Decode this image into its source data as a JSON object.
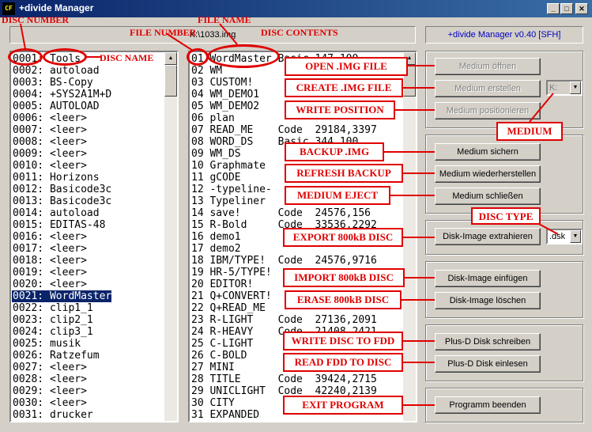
{
  "window": {
    "title": "+divide Manager",
    "app_icon": "CF",
    "controls": [
      "minimize",
      "maximize",
      "close"
    ]
  },
  "header": {
    "image_path": "K:\\1033.img",
    "version": "+divide Manager v0.40 [SFH]"
  },
  "discs": [
    "0001: Tools",
    "0002: autoload",
    "0003: BS-Copy",
    "0004: +SYS2A1M+D",
    "0005: AUTOLOAD",
    "0006: <leer>",
    "0007: <leer>",
    "0008: <leer>",
    "0009: <leer>",
    "0010: <leer>",
    "0011: Horizons",
    "0012: Basicode3c",
    "0013: Basicode3c",
    "0014: autoload",
    "0015: EDITAS-48",
    "0016: <leer>",
    "0017: <leer>",
    "0018: <leer>",
    "0019: <leer>",
    "0020: <leer>",
    "0021: WordMaster",
    "0022: clip1_1",
    "0023: clip2_1",
    "0024: clip3_1",
    "0025: musik",
    "0026: Ratzefum",
    "0027: <leer>",
    "0028: <leer>",
    "0029: <leer>",
    "0030: <leer>",
    "0031: drucker"
  ],
  "selected_disc_index": 20,
  "files": [
    "01 WordMaster Basic 147,100",
    "02 WM",
    "03 CUSTOM!",
    "04 WM_DEMO1",
    "05 WM_DEMO2",
    "06 plan",
    "07 READ_ME    Code  29184,3397",
    "08 WORD_DS    Basic 344,100",
    "09 WM_DS",
    "10 Graphmate",
    "11 gCODE",
    "12 -typeline-",
    "13 Typeliner",
    "14 save!      Code  24576,156",
    "15 R-Bold     Code  33536,2292",
    "16 demo1",
    "17 demo2",
    "18 IBM/TYPE!  Code  24576,9716",
    "19 HR-5/TYPE!",
    "20 EDITOR!",
    "21 Q+CONVERT!",
    "22 Q+READ_ME",
    "23 R-LIGHT    Code  27136,2091",
    "24 R-HEAVY    Code  21408,2421",
    "25 C-LIGHT",
    "26 C-BOLD",
    "27 MINI",
    "28 TITLE      Code  39424,2715",
    "29 UNICLIGHT  Code  42240,2139",
    "30 CITY",
    "31 EXPANDED"
  ],
  "buttons": {
    "open": "Medium öffnen",
    "create": "Medium erstellen",
    "position": "Medium positionieren",
    "backup": "Medium sichern",
    "restore": "Medium wiederherstellen",
    "close": "Medium schließen",
    "extract": "Disk-Image extrahieren",
    "insert": "Disk-Image einfügen",
    "delete": "Disk-Image löschen",
    "write_fdd": "Plus-D Disk schreiben",
    "read_fdd": "Plus-D Disk einlesen",
    "exit": "Programm beenden"
  },
  "medium_combo": {
    "value": "K:"
  },
  "disc_type_combo": {
    "value": ".dsk"
  },
  "annotations": {
    "disc_number": "DISC NUMBER",
    "disc_name": "DISC NAME",
    "file_number": "FILE NUMBER",
    "file_name": "FILE NAME",
    "disc_contents": "DISC CONTENTS",
    "open_img": "OPEN .IMG FILE",
    "create_img": "CREATE .IMG FILE",
    "write_position": "WRITE POSITION",
    "medium": "MEDIUM",
    "backup_img": "BACKUP .IMG",
    "refresh_backup": "REFRESH BACKUP",
    "medium_eject": "MEDIUM EJECT",
    "disc_type": "DISC TYPE",
    "export": "EXPORT 800kB DISC",
    "import": "IMPORT 800kB DISC",
    "erase": "ERASE 800kB DISC",
    "write_fdd": "WRITE DISC TO FDD",
    "read_fdd": "READ FDD TO DISC",
    "exit": "EXIT PROGRAM"
  },
  "colors": {
    "titlebar": "#0a246a",
    "annotation": "#e00000",
    "version_text": "#0000c0",
    "selection": "#0a246a"
  }
}
